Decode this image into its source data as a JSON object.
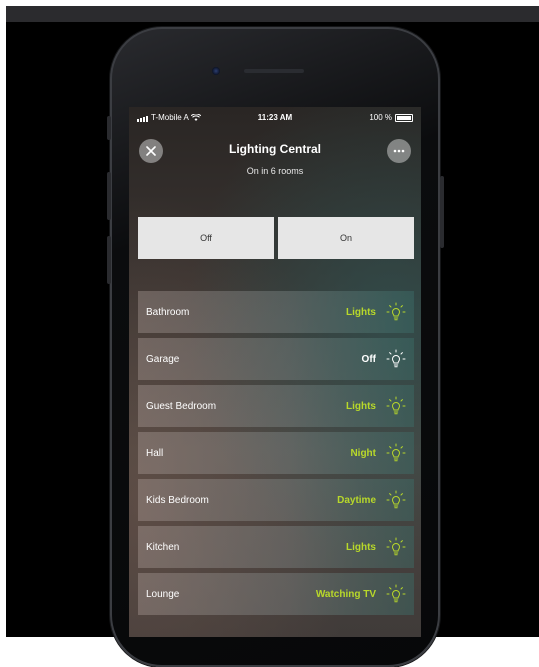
{
  "status_bar": {
    "carrier": "T-Mobile A",
    "time": "11:23 AM",
    "battery": "100 %"
  },
  "header": {
    "title": "Lighting Central",
    "subtitle": "On in 6 rooms",
    "close_icon": "close-icon",
    "more_icon": "more-icon"
  },
  "toggle": {
    "off_label": "Off",
    "on_label": "On"
  },
  "colors": {
    "accent_green": "#b8d82a",
    "off_white": "#ffffff"
  },
  "rooms": [
    {
      "name": "Bathroom",
      "state": "Lights",
      "active": true
    },
    {
      "name": "Garage",
      "state": "Off",
      "active": false
    },
    {
      "name": "Guest Bedroom",
      "state": "Lights",
      "active": true
    },
    {
      "name": "Hall",
      "state": "Night",
      "active": true
    },
    {
      "name": "Kids Bedroom",
      "state": "Daytime",
      "active": true
    },
    {
      "name": "Kitchen",
      "state": "Lights",
      "active": true
    },
    {
      "name": "Lounge",
      "state": "Watching TV",
      "active": true
    }
  ]
}
